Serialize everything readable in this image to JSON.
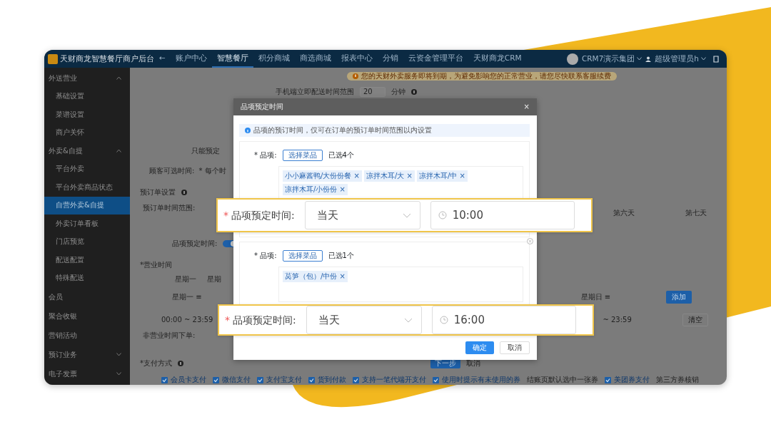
{
  "topbar": {
    "logo_text": "天财商龙智慧餐厅商户后台",
    "back": "←",
    "menu": [
      {
        "label": "账户中心",
        "selected": false
      },
      {
        "label": "智慧餐厅",
        "selected": true
      },
      {
        "label": "积分商城",
        "selected": false
      },
      {
        "label": "商选商城",
        "selected": false
      },
      {
        "label": "报表中心",
        "selected": false
      },
      {
        "label": "分销",
        "selected": false
      },
      {
        "label": "云资金管理平台",
        "selected": false
      },
      {
        "label": "天财商龙CRM",
        "selected": false
      }
    ],
    "group": "CRM7演示集团",
    "user": "超级管理员h"
  },
  "sidebar": {
    "items": [
      {
        "label": "外送营业",
        "expanded": true,
        "children": [
          {
            "label": "基础设置",
            "selected": false
          },
          {
            "label": "菜谱设置",
            "selected": false
          },
          {
            "label": "商户关怀",
            "selected": false
          }
        ]
      },
      {
        "label": "外卖&自提",
        "expanded": true,
        "children": [
          {
            "label": "平台外卖",
            "selected": false
          },
          {
            "label": "平台外卖商品状态",
            "selected": false
          },
          {
            "label": "自营外卖&自提",
            "selected": true
          },
          {
            "label": "外卖订单看板",
            "selected": false
          },
          {
            "label": "门店预览",
            "selected": false
          },
          {
            "label": "配送配置",
            "selected": false
          },
          {
            "label": "特殊配送",
            "selected": false
          }
        ]
      },
      {
        "label": "会员"
      },
      {
        "label": "聚合收银"
      },
      {
        "label": "营销活动"
      },
      {
        "label": "预订业务",
        "expanded": false
      },
      {
        "label": "电子发票",
        "expanded": false
      }
    ]
  },
  "page": {
    "notice": "您的天财外卖服务即将到期，为避免影响您的正常营业，请您尽快联系客服续费",
    "delivery_label": "手机端立即配送时间范围",
    "delivery_value": "20",
    "delivery_unit": "分钟",
    "preorder_only": "只能预定",
    "customer_time_label": "顾客可选时间:",
    "customer_time_value": "* 每个时",
    "preorder_section": "预订单设置",
    "preorder_range_label": "预订单时间范围:",
    "days": [
      "第六天",
      "第七天"
    ],
    "item_time_label": "品项预定时间:",
    "item_time_on": true,
    "hours_section": "*营业时间",
    "weekdays": [
      "星期一",
      "星期"
    ],
    "slot_day": "星期一 ≡",
    "slot_time": "00:00 ~ 23:59",
    "slot_time_right": "~ 23:59",
    "slot_day_right": "星期日 ≡",
    "add_button": "添加",
    "clear_button": "清空",
    "off_hours_label": "非营业时间下单:",
    "next_button": "下一步",
    "cancel_button": "取消",
    "payment_section": "*支付方式",
    "payments": [
      {
        "kind": "checkbox",
        "label": "会员卡支付",
        "checked": true
      },
      {
        "kind": "checkbox",
        "label": "微信支付",
        "checked": true
      },
      {
        "kind": "checkbox",
        "label": "支付宝支付",
        "checked": true
      },
      {
        "kind": "checkbox",
        "label": "货到付款",
        "checked": true
      },
      {
        "kind": "checkbox",
        "label": "支持一笔代端开支付",
        "checked": true
      },
      {
        "kind": "checkbox",
        "label": "使用时提示有未使用的券",
        "checked": true
      },
      {
        "kind": "text",
        "label": "结账页默认选中一张券"
      },
      {
        "kind": "checkbox",
        "label": "美团券支付",
        "checked": true
      },
      {
        "kind": "text",
        "label": "第三方券核销"
      }
    ]
  },
  "dialog": {
    "title": "品项预定时间",
    "close": "×",
    "info": "品项的预订时间，仅可在订单的预订单时间范围以内设置",
    "groups": [
      {
        "label": "* 品项:",
        "button": "选择菜品",
        "count": "已选4个",
        "removable": false,
        "tags": [
          "小小麻酱鸭/大份份餐 ×",
          "凉拌木耳/大 ×",
          "凉拌木耳/中 ×",
          "凉拌木耳/小份份 ×"
        ]
      },
      {
        "label": "* 品项:",
        "button": "选择菜品",
        "count": "已选1个",
        "removable": true,
        "tags": [
          "莴笋（包）/中份 ×"
        ]
      }
    ],
    "ok": "确定",
    "cancel": "取消"
  },
  "callouts": [
    {
      "star": "*",
      "label": "品项预定时间:",
      "day": "当天",
      "time": "10:00"
    },
    {
      "star": "*",
      "label": "品项预定时间:",
      "day": "当天",
      "time": "16:00"
    }
  ]
}
